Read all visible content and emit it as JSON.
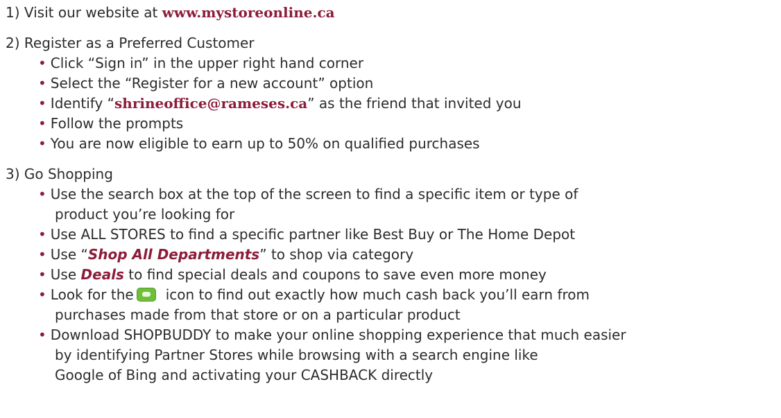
{
  "colors": {
    "text": "#2b2b2b",
    "accent": "#8c1c3a",
    "icon_green": "#6fbf3a"
  },
  "step1": {
    "prefix": "1) Visit our website at ",
    "link": "www.mystoreonline.ca"
  },
  "step2": {
    "title": "2) Register as a Preferred Customer",
    "b1": "Click “Sign in” in the upper right hand corner",
    "b2": "Select the “Register for a new account” option",
    "b3_pre": "Identify “",
    "b3_email": "shrineoffice@rameses.ca",
    "b3_post": "” as the friend that invited you",
    "b4": "Follow the prompts",
    "b5": "You are now eligible to earn up to 50% on qualified purchases"
  },
  "step3": {
    "title": "3) Go Shopping",
    "b1_l1": "Use the search box at the top of the screen to find a specific item or type of",
    "b1_l2": "product you’re looking for",
    "b2": "Use ALL STORES to find a specific partner like Best Buy or The Home Depot",
    "b3_pre": "Use “",
    "b3_emph": "Shop All Departments",
    "b3_post": "” to shop via category",
    "b4_pre": "Use ",
    "b4_emph": "Deals",
    "b4_post": " to find special deals and coupons to save even more money",
    "b5_pre": "Look for the",
    "b5_icon": "cashback-icon",
    "b5_post": "icon to find out exactly how much cash back you’ll earn from",
    "b5_l2": "purchases made from that store or on a particular product",
    "b6_l1": "Download SHOPBUDDY to make your online shopping experience that much easier",
    "b6_l2": "by identifying Partner Stores while browsing with a search engine like",
    "b6_l3": "Google of Bing and activating your CASHBACK directly"
  },
  "bullet_char": "•"
}
